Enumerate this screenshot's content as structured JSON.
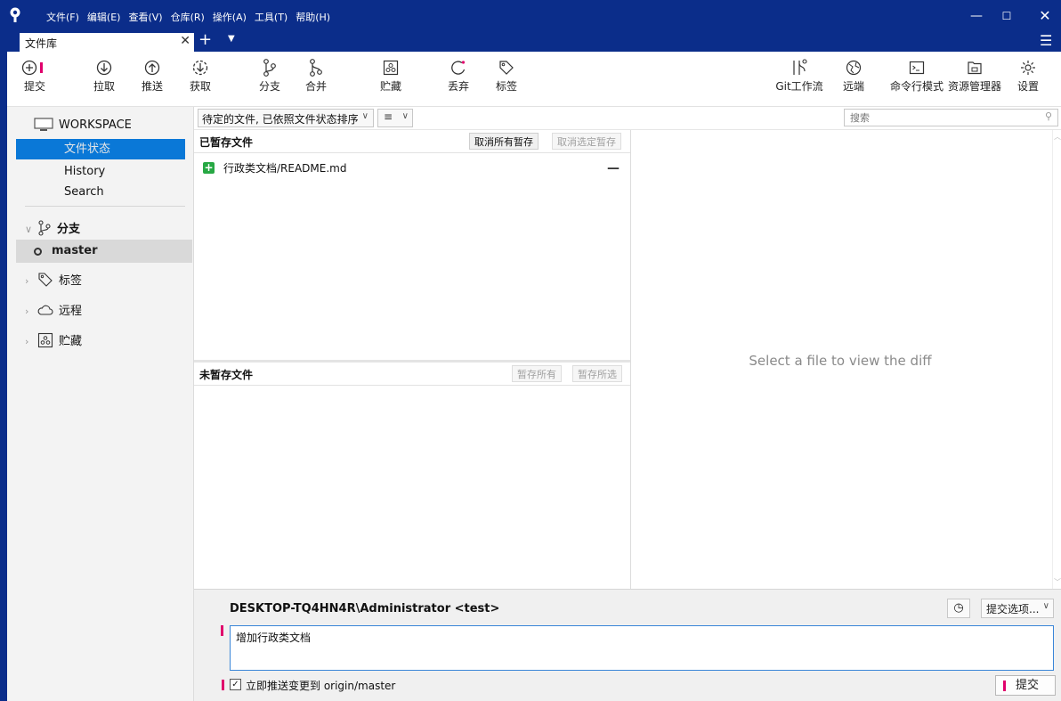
{
  "menubar": [
    "文件(F)",
    "编辑(E)",
    "查看(V)",
    "仓库(R)",
    "操作(A)",
    "工具(T)",
    "帮助(H)"
  ],
  "tab": {
    "label": "文件库"
  },
  "toolbar": {
    "commit": "提交",
    "pull": "拉取",
    "push": "推送",
    "fetch": "获取",
    "branch": "分支",
    "merge": "合并",
    "stash": "贮藏",
    "discard": "丢弃",
    "tag": "标签",
    "gitflow": "Git工作流",
    "remote": "远端",
    "terminal": "命令行模式",
    "explorer": "资源管理器",
    "settings": "设置"
  },
  "sidebar": {
    "workspace": "WORKSPACE",
    "items": [
      "文件状态",
      "History",
      "Search"
    ],
    "branches_label": "分支",
    "current_branch": "master",
    "tags_label": "标签",
    "remotes_label": "远程",
    "stashes_label": "贮藏"
  },
  "filter": {
    "sort": "待定的文件, 已依照文件状态排序",
    "view": "≡",
    "search_placeholder": "搜索"
  },
  "staged": {
    "title": "已暂存文件",
    "unstage_all": "取消所有暂存",
    "unstage_selected": "取消选定暂存",
    "files": [
      {
        "name": "行政类文档/README.md",
        "status": "added"
      }
    ]
  },
  "unstaged": {
    "title": "未暂存文件",
    "stage_all": "暂存所有",
    "stage_selected": "暂存所选"
  },
  "diff": {
    "placeholder": "Select a file to view the diff"
  },
  "commit": {
    "author": "DESKTOP-TQ4HN4R\\Administrator <test>",
    "options": "提交选项...",
    "message": "增加行政类文档",
    "push_label": "立即推送变更到 origin/master",
    "push_checked": true,
    "button": "提交"
  },
  "colors": {
    "titlebar": "#0b2d8a",
    "selection": "#0a78d7",
    "added": "#27a844",
    "marker": "#e0006c"
  }
}
